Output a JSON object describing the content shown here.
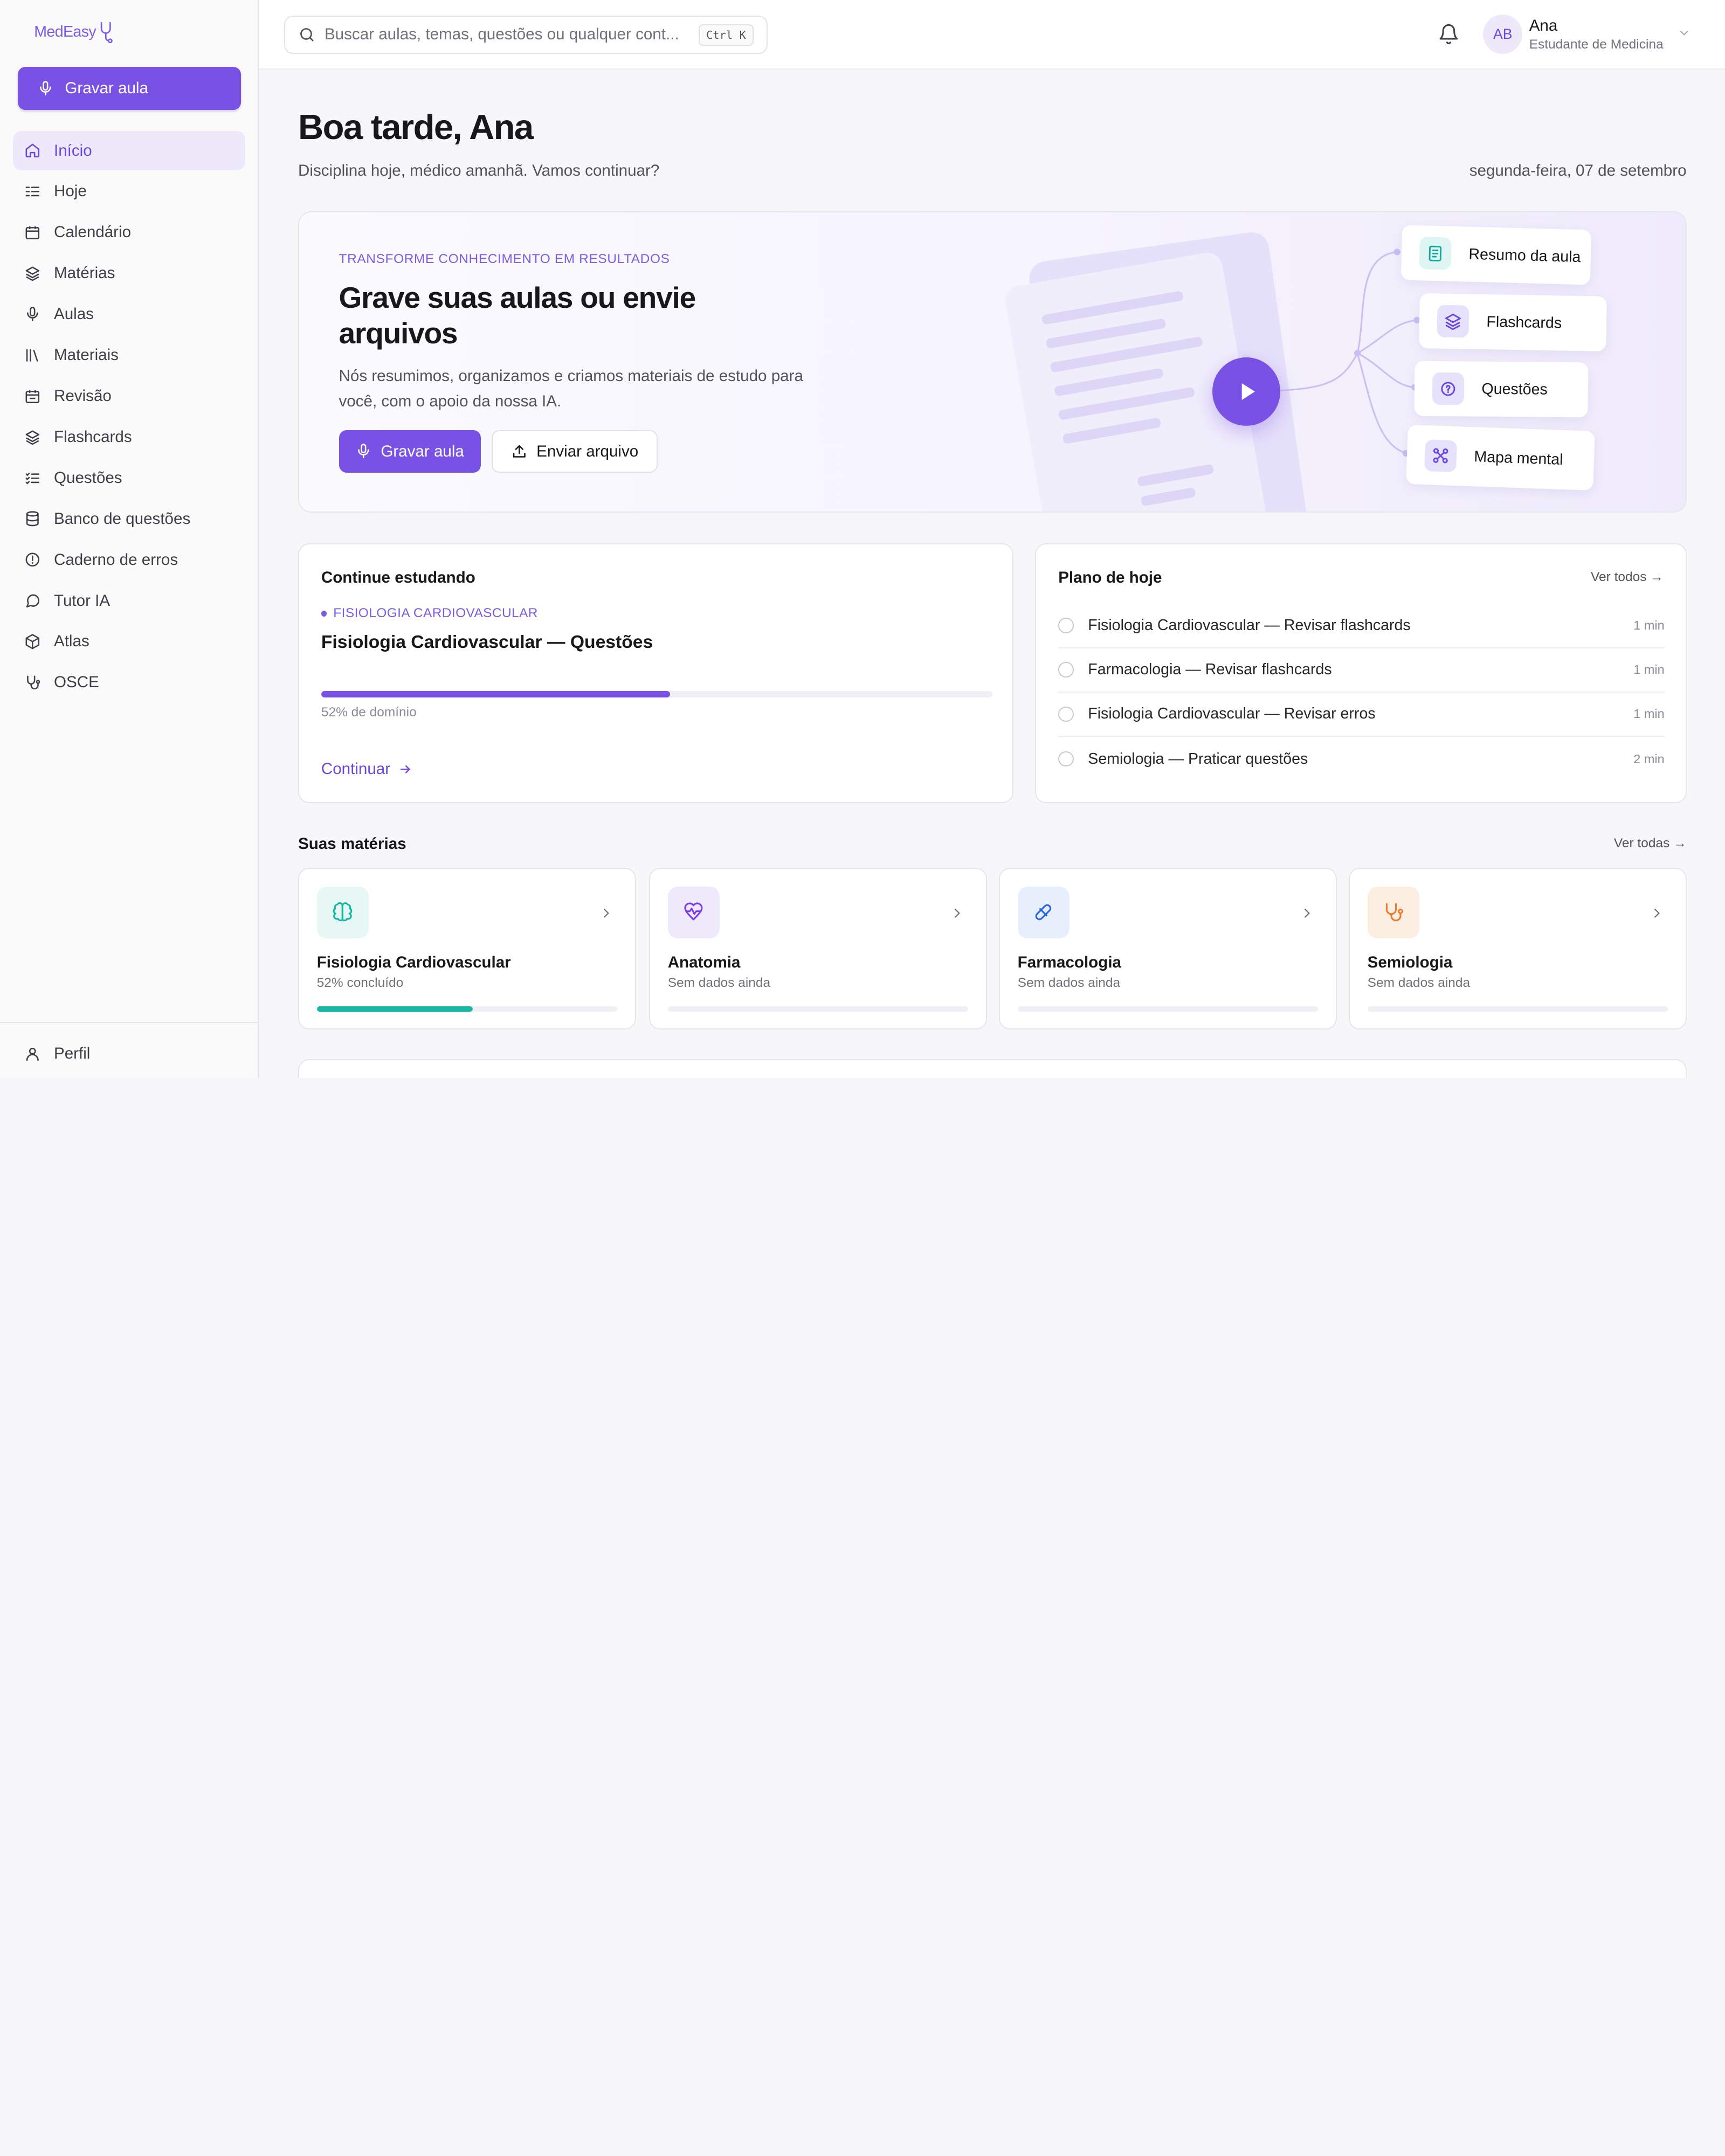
{
  "app": {
    "logo": "MedEasy"
  },
  "sidebar": {
    "record_label": "Gravar aula",
    "items": [
      {
        "label": "Início",
        "icon": "home-icon"
      },
      {
        "label": "Hoje",
        "icon": "list-icon"
      },
      {
        "label": "Calendário",
        "icon": "calendar-icon"
      },
      {
        "label": "Matérias",
        "icon": "layers-icon"
      },
      {
        "label": "Aulas",
        "icon": "mic-icon"
      },
      {
        "label": "Materiais",
        "icon": "library-icon"
      },
      {
        "label": "Revisão",
        "icon": "calendar-check-icon"
      },
      {
        "label": "Flashcards",
        "icon": "layers-icon"
      },
      {
        "label": "Questões",
        "icon": "checklist-icon"
      },
      {
        "label": "Banco de questões",
        "icon": "database-icon"
      },
      {
        "label": "Caderno de erros",
        "icon": "alert-circle-icon"
      },
      {
        "label": "Tutor IA",
        "icon": "chat-icon"
      },
      {
        "label": "Atlas",
        "icon": "box-icon"
      },
      {
        "label": "OSCE",
        "icon": "stethoscope-icon"
      }
    ],
    "profile_label": "Perfil"
  },
  "topbar": {
    "search_placeholder": "Buscar aulas, temas, questões ou qualquer cont...",
    "shortcut": "Ctrl K",
    "user": {
      "initials": "AB",
      "name": "Ana",
      "role": "Estudante de Medicina"
    }
  },
  "greeting": {
    "title": "Boa tarde, Ana",
    "subtitle": "Disciplina hoje, médico amanhã. Vamos continuar?",
    "date": "segunda-feira, 07 de setembro"
  },
  "hero": {
    "eyebrow": "TRANSFORME CONHECIMENTO EM RESULTADOS",
    "title": "Grave suas aulas ou envie arquivos",
    "description": "Nós resumimos, organizamos e criamos materiais de estudo para você, com o apoio da nossa IA.",
    "primary_label": "Gravar aula",
    "secondary_label": "Enviar arquivo",
    "outputs": [
      "Resumo da aula",
      "Flashcards",
      "Questões",
      "Mapa mental"
    ]
  },
  "continue": {
    "title": "Continue estudando",
    "tag": "FISIOLOGIA CARDIOVASCULAR",
    "name": "Fisiologia Cardiovascular — Questões",
    "progress": 0.52,
    "progress_label": "52% de domínio",
    "link": "Continuar",
    "accent": "#7952e5"
  },
  "plan": {
    "title": "Plano de hoje",
    "link": "Ver todos →",
    "items": [
      {
        "text": "Fisiologia Cardiovascular — Revisar flashcards",
        "time": "1 min"
      },
      {
        "text": "Farmacologia — Revisar flashcards",
        "time": "1 min"
      },
      {
        "text": "Fisiologia Cardiovascular — Revisar erros",
        "time": "1 min"
      },
      {
        "text": "Semiologia — Praticar questões",
        "time": "2 min"
      }
    ]
  },
  "subjects": {
    "title": "Suas matérias",
    "link": "Ver todas →",
    "items": [
      {
        "name": "Fisiologia Cardiovascular",
        "meta": "52% concluído",
        "progress": 0.52,
        "icon": "brain-icon",
        "color": "#14b8a6",
        "bg": "#e6f7f4"
      },
      {
        "name": "Anatomia",
        "meta": "Sem dados ainda",
        "progress": 0,
        "icon": "heart-pulse-icon",
        "color": "#7c3aed",
        "bg": "#efeafb"
      },
      {
        "name": "Farmacologia",
        "meta": "Sem dados ainda",
        "progress": 0,
        "icon": "pill-icon",
        "color": "#2563eb",
        "bg": "#e8effc"
      },
      {
        "name": "Semiologia",
        "meta": "Sem dados ainda",
        "progress": 0,
        "icon": "stethoscope-icon",
        "color": "#ea7a2c",
        "bg": "#fdeee2"
      }
    ]
  }
}
